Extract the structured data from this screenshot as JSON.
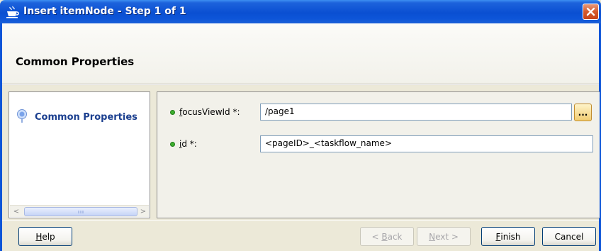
{
  "window": {
    "title": "Insert itemNode - Step 1 of 1",
    "app_icon": "coffee-cup-icon",
    "close_label": "✕"
  },
  "header": {
    "heading": "Common Properties"
  },
  "nav": {
    "items": [
      {
        "label": "Common Properties",
        "icon": "step-bulb-icon",
        "selected": true
      }
    ],
    "scroll_left": "<",
    "scroll_right": ">"
  },
  "properties": {
    "focus_view_id": {
      "label_mnemonic": "f",
      "label_rest": "ocusViewId *:",
      "value": "/page1",
      "browse_label": "..."
    },
    "id": {
      "label_mnemonic": "i",
      "label_rest": "d *:",
      "value": "<pageID>_<taskflow_name>"
    }
  },
  "buttons": {
    "help": {
      "mnemonic": "H",
      "rest": "elp"
    },
    "back": {
      "pre": "< ",
      "mnemonic": "B",
      "rest": "ack",
      "enabled": false
    },
    "next": {
      "mnemonic": "N",
      "rest": "ext >",
      "enabled": false
    },
    "finish": {
      "mnemonic": "F",
      "rest": "inish"
    },
    "cancel": {
      "label": "Cancel"
    }
  },
  "colors": {
    "title_bar": "#0a4fd2",
    "required_dot": "#3fb02f",
    "nav_selected_text": "#1b3f8f"
  }
}
